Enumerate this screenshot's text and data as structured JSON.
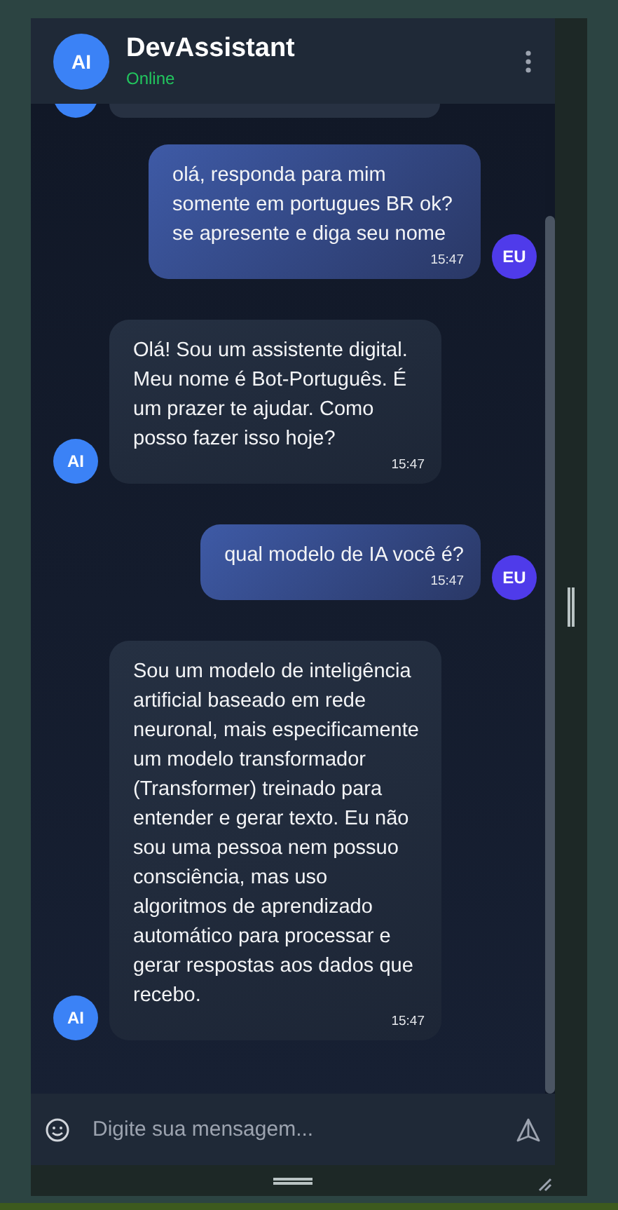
{
  "header": {
    "avatar": "AI",
    "title": "DevAssistant",
    "status": "Online"
  },
  "messages": [
    {
      "kind": "user",
      "avatar": "EU",
      "text": "olá, responda para mim somente em portugues BR ok? se apresente e diga seu nome",
      "time": "15:47"
    },
    {
      "kind": "ai",
      "avatar": "AI",
      "text": "Olá! Sou um assistente digital. Meu nome é Bot-Português. É um prazer te ajudar. Como posso fazer isso hoje?",
      "time": "15:47"
    },
    {
      "kind": "user",
      "avatar": "EU",
      "text": "qual modelo de IA você é?",
      "time": "15:47"
    },
    {
      "kind": "ai",
      "avatar": "AI",
      "text": "Sou um modelo de inteligência artificial baseado em rede neuronal, mais especificamente um modelo transformador (Transformer) treinado para entender e gerar texto. Eu não sou uma pessoa nem possuo consciência, mas uso algoritmos de aprendizado automático para processar e gerar respostas aos dados que recebo.",
      "time": "15:47"
    }
  ],
  "input": {
    "placeholder": "Digite sua mensagem..."
  }
}
